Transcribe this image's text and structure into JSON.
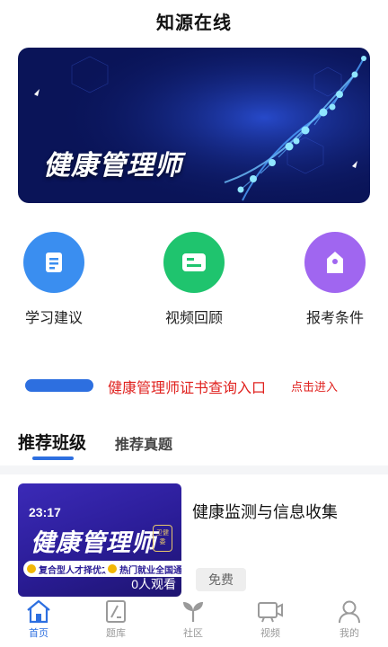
{
  "header": {
    "title": "知源在线"
  },
  "banner": {
    "text": "健康管理师"
  },
  "quick_actions": [
    {
      "label": "学习建议",
      "icon": "document-icon",
      "color": "#3a8ef0"
    },
    {
      "label": "视频回顾",
      "icon": "video-card-icon",
      "color": "#1fc46e"
    },
    {
      "label": "报考条件",
      "icon": "tag-icon",
      "color": "#a066f0"
    }
  ],
  "notice": {
    "main_text": "健康管理师证书查询入口",
    "sub_text": "点击进入"
  },
  "tabs": {
    "active": "推荐班级",
    "inactive": "推荐真题"
  },
  "course": {
    "time": "23:17",
    "thumb_title": "健康管理师",
    "thumb_tag": "卫健委",
    "badge_left": "复合型人才择优之选",
    "badge_right": "热门就业全国通用",
    "viewers": "0人观看",
    "name": "健康监测与信息收集",
    "price": "免费"
  },
  "bottom_nav": [
    {
      "label": "首页",
      "icon": "home-icon",
      "active": true
    },
    {
      "label": "题库",
      "icon": "question-bank-icon",
      "active": false
    },
    {
      "label": "社区",
      "icon": "sprout-icon",
      "active": false
    },
    {
      "label": "视频",
      "icon": "video-camera-icon",
      "active": false
    },
    {
      "label": "我的",
      "icon": "user-icon",
      "active": false
    }
  ],
  "colors": {
    "accent": "#2d6fe0",
    "notice_red": "#e0221f",
    "banner_bg": "#0a1458"
  }
}
